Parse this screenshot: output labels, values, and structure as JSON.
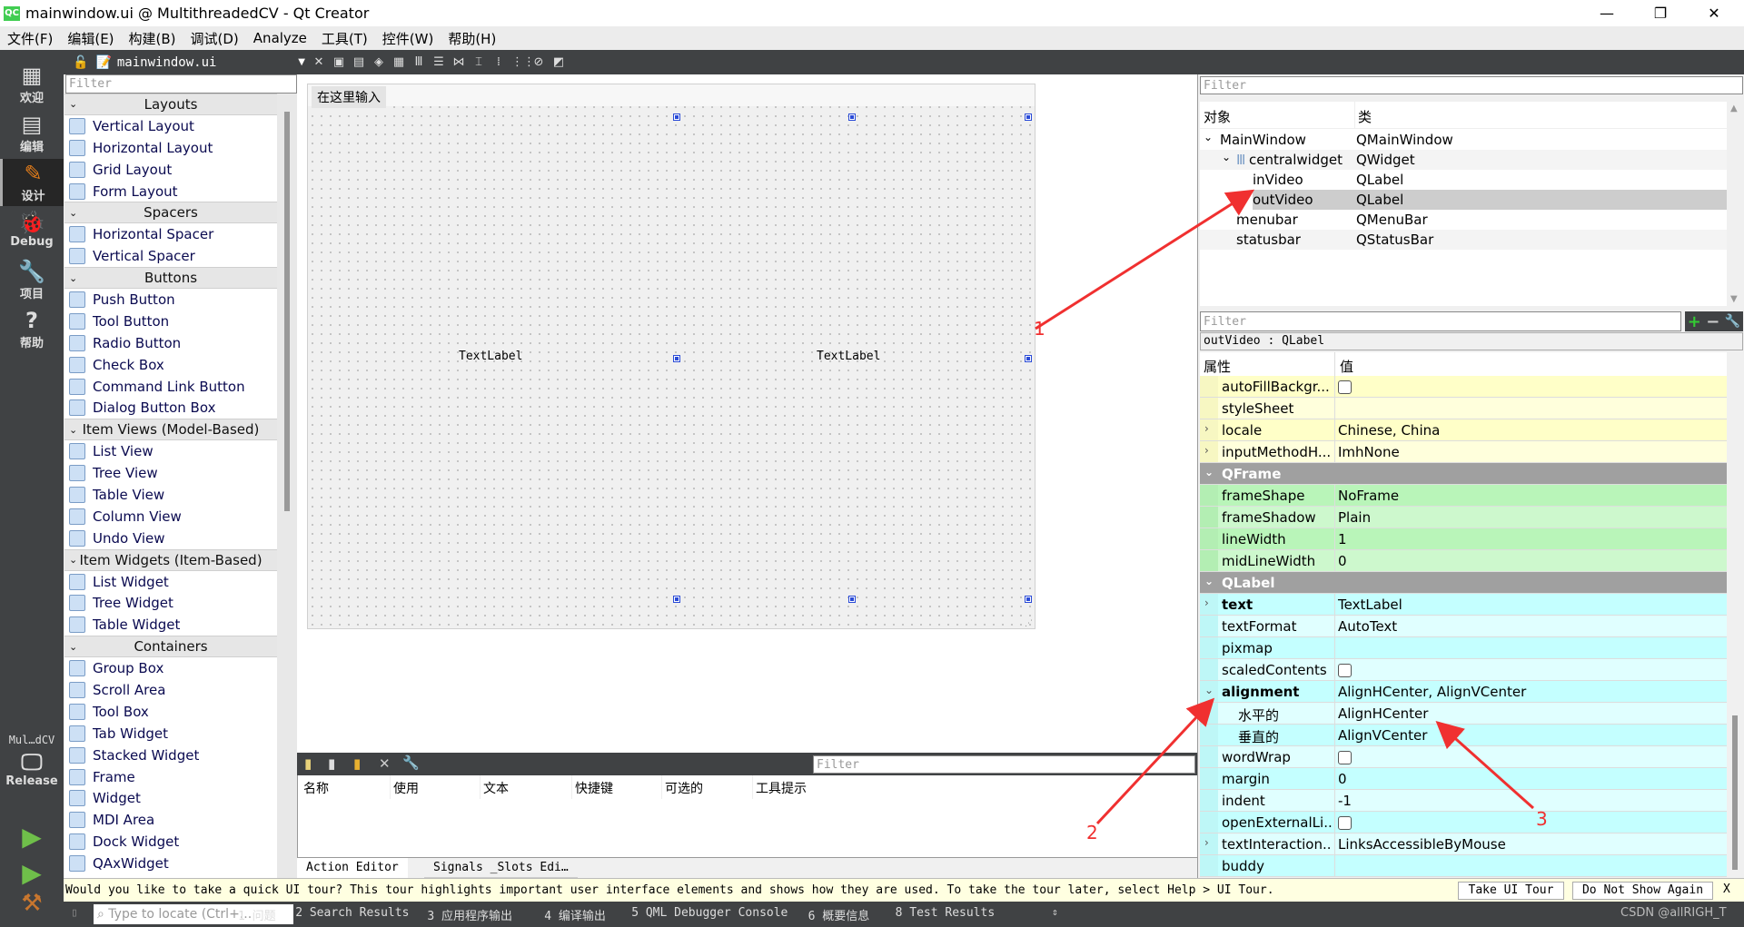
{
  "window": {
    "title": "mainwindow.ui @ MultithreadedCV - Qt Creator",
    "logo": "QC",
    "controls": [
      "—",
      "❐",
      "✕"
    ]
  },
  "menubar": [
    "文件(F)",
    "编辑(E)",
    "构建(B)",
    "调试(D)",
    "Analyze",
    "工具(T)",
    "控件(W)",
    "帮助(H)"
  ],
  "toolbar": {
    "file": "mainwindow.ui"
  },
  "modes": [
    {
      "label": "欢迎",
      "icon": "grid-icon"
    },
    {
      "label": "编辑",
      "icon": "document-icon"
    },
    {
      "label": "设计",
      "icon": "pencil-icon",
      "active": true
    },
    {
      "label": "Debug",
      "icon": "bug-icon"
    },
    {
      "label": "项目",
      "icon": "wrench-icon"
    },
    {
      "label": "帮助",
      "icon": "help-icon"
    }
  ],
  "kit": {
    "project": "Mul…dCV",
    "config": "Release"
  },
  "widgetbox": {
    "filter_placeholder": "Filter",
    "items": [
      {
        "cat": "Layouts"
      },
      {
        "label": "Vertical Layout"
      },
      {
        "label": "Horizontal Layout"
      },
      {
        "label": "Grid Layout"
      },
      {
        "label": "Form Layout"
      },
      {
        "cat": "Spacers"
      },
      {
        "label": "Horizontal Spacer"
      },
      {
        "label": "Vertical Spacer"
      },
      {
        "cat": "Buttons"
      },
      {
        "label": "Push Button"
      },
      {
        "label": "Tool Button"
      },
      {
        "label": "Radio Button"
      },
      {
        "label": "Check Box"
      },
      {
        "label": "Command Link Button"
      },
      {
        "label": "Dialog Button Box"
      },
      {
        "cat": "Item Views (Model-Based)"
      },
      {
        "label": "List View"
      },
      {
        "label": "Tree View"
      },
      {
        "label": "Table View"
      },
      {
        "label": "Column View"
      },
      {
        "label": "Undo View"
      },
      {
        "cat": "Item Widgets (Item-Based)"
      },
      {
        "label": "List Widget"
      },
      {
        "label": "Tree Widget"
      },
      {
        "label": "Table Widget"
      },
      {
        "cat": "Containers"
      },
      {
        "label": "Group Box"
      },
      {
        "label": "Scroll Area"
      },
      {
        "label": "Tool Box"
      },
      {
        "label": "Tab Widget"
      },
      {
        "label": "Stacked Widget"
      },
      {
        "label": "Frame"
      },
      {
        "label": "Widget"
      },
      {
        "label": "MDI Area"
      },
      {
        "label": "Dock Widget"
      },
      {
        "label": "QAxWidget"
      }
    ]
  },
  "form": {
    "menu_placeholder": "在这里输入",
    "label1": "TextLabel",
    "label2": "TextLabel"
  },
  "action_editor": {
    "filter_placeholder": "Filter",
    "columns": [
      "名称",
      "使用",
      "文本",
      "快捷键",
      "可选的",
      "工具提示"
    ],
    "tabs": [
      "Action Editor",
      "Signals _Slots Edi…"
    ]
  },
  "object_inspector": {
    "filter_placeholder": "Filter",
    "columns": [
      "对象",
      "类"
    ],
    "rows": [
      {
        "name": "MainWindow",
        "cls": "QMainWindow",
        "depth": 0,
        "expanded": true
      },
      {
        "name": "centralwidget",
        "cls": "QWidget",
        "depth": 1,
        "expanded": true
      },
      {
        "name": "inVideo",
        "cls": "QLabel",
        "depth": 2
      },
      {
        "name": "outVideo",
        "cls": "QLabel",
        "depth": 2,
        "selected": true
      },
      {
        "name": "menubar",
        "cls": "QMenuBar",
        "depth": 1
      },
      {
        "name": "statusbar",
        "cls": "QStatusBar",
        "depth": 1
      }
    ]
  },
  "property_editor": {
    "filter_placeholder": "Filter",
    "object": "outVideo : QLabel",
    "columns": [
      "属性",
      "值"
    ],
    "colors": {
      "qwidget": "#ffffc8",
      "qwidget_alt": "#ffffdc",
      "qframe": "#b9f5b9",
      "qframe_alt": "#cdf8cd",
      "qlabel": "#c4ffff",
      "qlabel_alt": "#e0ffff",
      "section": "#a0a0a0"
    },
    "rows": [
      {
        "name": "autoFillBackgr...",
        "value": "",
        "checkbox": true,
        "group": "qwidget"
      },
      {
        "name": "styleSheet",
        "value": "",
        "group": "qwidget"
      },
      {
        "name": "locale",
        "value": "Chinese, China",
        "group": "qwidget",
        "expand": "›"
      },
      {
        "name": "inputMethodH...",
        "value": "ImhNone",
        "group": "qwidget",
        "expand": "›"
      },
      {
        "name": "QFrame",
        "section": true
      },
      {
        "name": "frameShape",
        "value": "NoFrame",
        "group": "qframe"
      },
      {
        "name": "frameShadow",
        "value": "Plain",
        "group": "qframe"
      },
      {
        "name": "lineWidth",
        "value": "1",
        "group": "qframe"
      },
      {
        "name": "midLineWidth",
        "value": "0",
        "group": "qframe"
      },
      {
        "name": "QLabel",
        "section": true
      },
      {
        "name": "text",
        "value": "TextLabel",
        "group": "qlabel",
        "bold": true,
        "expand": "›"
      },
      {
        "name": "textFormat",
        "value": "AutoText",
        "group": "qlabel"
      },
      {
        "name": "pixmap",
        "value": "",
        "group": "qlabel"
      },
      {
        "name": "scaledContents",
        "value": "",
        "checkbox": true,
        "group": "qlabel"
      },
      {
        "name": "alignment",
        "value": "AlignHCenter, AlignVCenter",
        "group": "qlabel",
        "bold": true,
        "expand": "⌄"
      },
      {
        "name": "水平的",
        "value": "AlignHCenter",
        "group": "qlabel",
        "child": true
      },
      {
        "name": "垂直的",
        "value": "AlignVCenter",
        "group": "qlabel",
        "child": true
      },
      {
        "name": "wordWrap",
        "value": "",
        "checkbox": true,
        "group": "qlabel"
      },
      {
        "name": "margin",
        "value": "0",
        "group": "qlabel"
      },
      {
        "name": "indent",
        "value": "-1",
        "group": "qlabel"
      },
      {
        "name": "openExternalLi...",
        "value": "",
        "checkbox": true,
        "group": "qlabel"
      },
      {
        "name": "textInteraction...",
        "value": "LinksAccessibleByMouse",
        "group": "qlabel",
        "expand": "›"
      },
      {
        "name": "buddy",
        "value": "",
        "group": "qlabel"
      }
    ]
  },
  "tour": {
    "message": "Would you like to take a quick UI tour? This tour highlights important user interface elements and shows how they are used. To take the tour later, select Help > UI Tour.",
    "take": "Take UI Tour",
    "dismiss": "Do Not Show Again",
    "close": "X"
  },
  "statusbar": {
    "locator_placeholder": "Type to locate (Ctrl+...",
    "tabs": [
      "1 问题",
      "2 Search Results",
      "3 应用程序输出",
      "4 编译输出",
      "5 QML Debugger Console",
      "6 概要信息",
      "8 Test Results"
    ],
    "watermark": "CSDN @allRIGH_T"
  },
  "annotations": {
    "color": "#f03030",
    "labels": [
      "1",
      "2",
      "3"
    ]
  }
}
